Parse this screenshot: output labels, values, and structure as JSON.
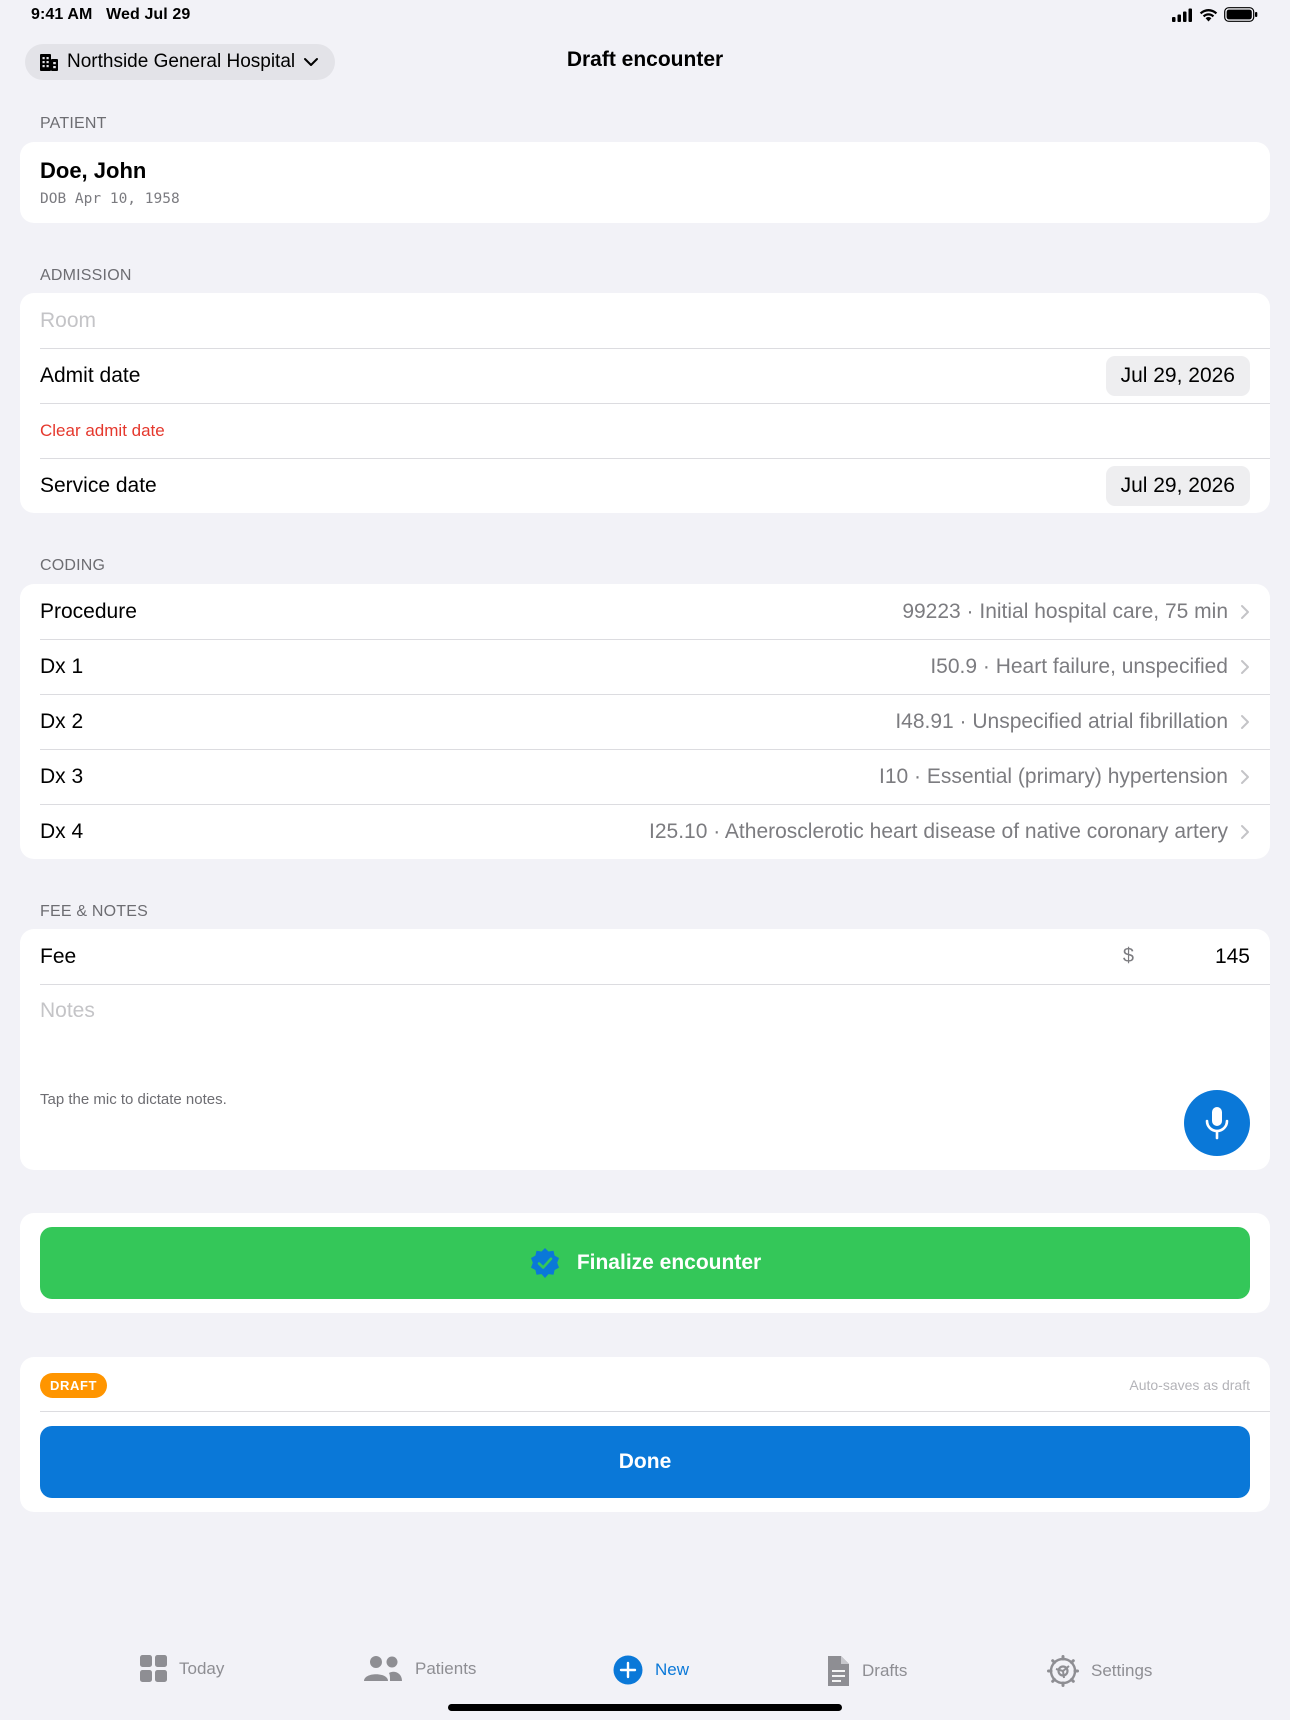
{
  "status_bar": {
    "time": "9:41 AM",
    "date": "Wed Jul 29"
  },
  "nav": {
    "facility": "Northside General Hospital",
    "title": "Draft encounter"
  },
  "patient": {
    "header": "PATIENT",
    "name": "Doe, John",
    "dob": "DOB Apr 10, 1958"
  },
  "admission": {
    "header": "ADMISSION",
    "room_placeholder": "Room",
    "admit_label": "Admit date",
    "admit_value": "Jul 29, 2026",
    "clear_admit": "Clear admit date",
    "service_label": "Service date",
    "service_value": "Jul 29, 2026"
  },
  "coding": {
    "header": "CODING",
    "rows": [
      {
        "label": "Procedure",
        "value": "99223 · Initial hospital care, 75 min"
      },
      {
        "label": "Dx 1",
        "value": "I50.9 · Heart failure, unspecified"
      },
      {
        "label": "Dx 2",
        "value": "I48.91 · Unspecified atrial fibrillation"
      },
      {
        "label": "Dx 3",
        "value": "I10 · Essential (primary) hypertension"
      },
      {
        "label": "Dx 4",
        "value": "I25.10 · Atherosclerotic heart disease of native coronary artery"
      }
    ]
  },
  "fee_notes": {
    "header": "FEE & NOTES",
    "fee_label": "Fee",
    "currency": "$",
    "fee_value": "145",
    "notes_placeholder": "Notes",
    "mic_hint": "Tap the mic to dictate notes."
  },
  "actions": {
    "finalize_label": "Finalize encounter",
    "draft_badge": "DRAFT",
    "autosave": "Auto-saves as draft",
    "done_label": "Done"
  },
  "tabs": [
    {
      "label": "Today",
      "icon": "grid-icon"
    },
    {
      "label": "Patients",
      "icon": "people-icon"
    },
    {
      "label": "New",
      "icon": "plus-circle-icon",
      "active": true
    },
    {
      "label": "Drafts",
      "icon": "document-icon"
    },
    {
      "label": "Settings",
      "icon": "gear-icon"
    }
  ],
  "colors": {
    "accent": "#0a78d8",
    "finalize": "#34c759",
    "draft": "#ff9500",
    "destructive": "#e5382d"
  }
}
